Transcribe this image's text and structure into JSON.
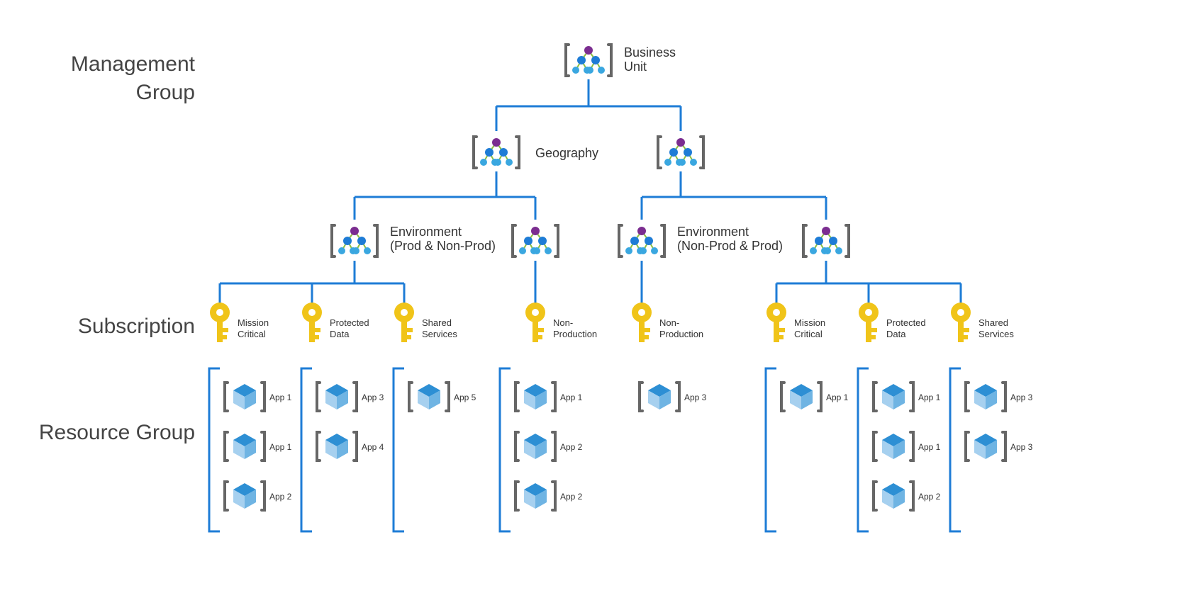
{
  "sideLabels": {
    "management1": "Management",
    "management2": "Group",
    "subscription": "Subscription",
    "resourceGroup": "Resource Group"
  },
  "nodes": {
    "businessUnit1": "Business",
    "businessUnit2": "Unit",
    "geography": "Geography",
    "envLeft1": "Environment",
    "envLeft2": "(Prod & Non-Prod)",
    "envRight1": "Environment",
    "envRight2": "(Non-Prod & Prod)"
  },
  "subs": {
    "s0a": "Mission",
    "s0b": "Critical",
    "s1a": "Protected",
    "s1b": "Data",
    "s2a": "Shared",
    "s2b": "Services",
    "s3a": "Non-",
    "s3b": "Production",
    "s4a": "Non-",
    "s4b": "Production",
    "s5a": "Mission",
    "s5b": "Critical",
    "s6a": "Protected",
    "s6b": "Data",
    "s7a": "Shared",
    "s7b": "Services"
  },
  "apps": {
    "a00": "App 1",
    "a01": "App 1",
    "a02": "App 2",
    "a10": "App 3",
    "a11": "App 4",
    "a20": "App 5",
    "a30": "App 1",
    "a31": "App 2",
    "a32": "App 2",
    "a40": "App 3",
    "a50": "App 1",
    "a60": "App 1",
    "a61": "App 1",
    "a62": "App 2",
    "a70": "App 3",
    "a71": "App 3"
  }
}
